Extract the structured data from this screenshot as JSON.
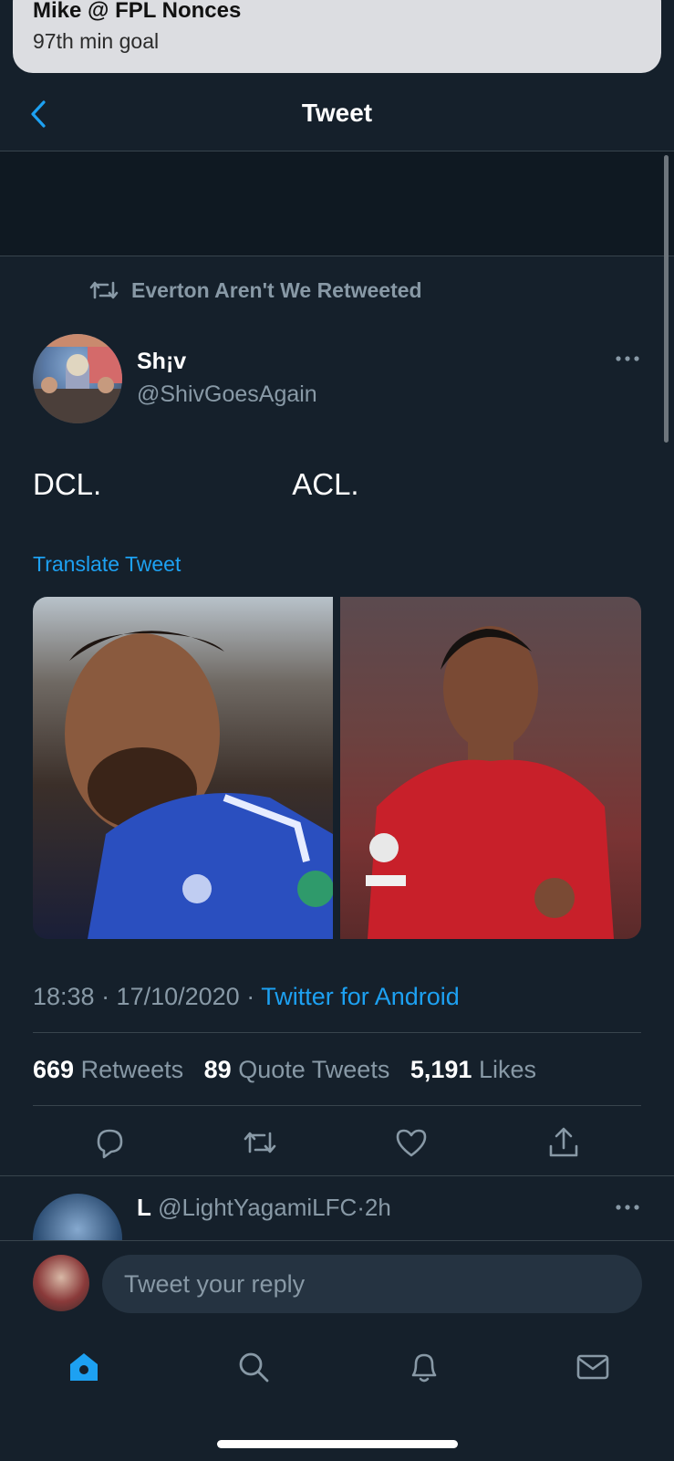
{
  "notification": {
    "title": "Mike @ FPL Nonces",
    "body": "97th min goal"
  },
  "header": {
    "title": "Tweet"
  },
  "retweet_context": "Everton Aren't We Retweeted",
  "tweet": {
    "author_name": "Sh¡v",
    "author_handle": "@ShivGoesAgain",
    "text": "DCL.                       ACL.",
    "translate_label": "Translate Tweet",
    "images": [
      {
        "label": "Everton player smiling"
      },
      {
        "label": "Liverpool player"
      }
    ],
    "time": "18:38 · 17/10/2020 · ",
    "source": "Twitter for Android",
    "retweets_count": "669",
    "retweets_label": "Retweets",
    "quotes_count": "89",
    "quotes_label": "Quote Tweets",
    "likes_count": "5,191",
    "likes_label": "Likes"
  },
  "reply": {
    "name": "L",
    "handle": "@LightYagamiLFC",
    "age": "2h"
  },
  "composer": {
    "placeholder": "Tweet your reply"
  },
  "icons": {
    "back": "chevron-left-icon",
    "retweet": "retweet-icon",
    "more": "more-icon",
    "reply": "reply-icon",
    "like": "heart-icon",
    "share": "share-icon",
    "home": "home-icon",
    "search": "search-icon",
    "notifications": "bell-icon",
    "messages": "mail-icon"
  },
  "colors": {
    "background": "#15202b",
    "accent": "#1da1f2",
    "secondary_text": "#8899a6"
  }
}
